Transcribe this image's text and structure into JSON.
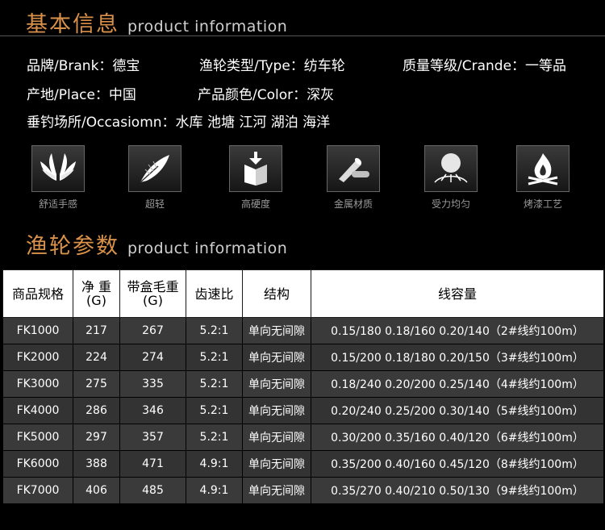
{
  "section1": {
    "title_cn": "基本信息",
    "title_en": "product information"
  },
  "info": {
    "row1": [
      "品牌/Brank：德宝",
      "渔轮类型/Type：纺车轮",
      "质量等级/Crande：一等品"
    ],
    "row2": [
      "产地/Place：中国",
      "产品颜色/Color：深灰"
    ],
    "row3": [
      "垂钓场所/Occasiomn：水库  池塘  江河  湖泊  海洋"
    ]
  },
  "features": [
    {
      "label": "舒适手感",
      "icon": "hands-icon"
    },
    {
      "label": "超轻",
      "icon": "feather-icon"
    },
    {
      "label": "高硬度",
      "icon": "hardness-icon"
    },
    {
      "label": "金属材质",
      "icon": "metal-rod-icon"
    },
    {
      "label": "受力均匀",
      "icon": "force-ball-icon"
    },
    {
      "label": "烤漆工艺",
      "icon": "flame-icon"
    }
  ],
  "section2": {
    "title_cn": "渔轮参数",
    "title_en": "product information"
  },
  "table": {
    "headers": [
      "商品规格",
      "净 重\n(G)",
      "带盒毛重\n(G)",
      "齿速比",
      "结构",
      "线容量"
    ],
    "rows": [
      [
        "FK1000",
        "217",
        "267",
        "5.2:1",
        "单向无间隙",
        "0.15/180  0.18/160  0.20/140（2#线约100m）"
      ],
      [
        "FK2000",
        "224",
        "274",
        "5.2:1",
        "单向无间隙",
        "0.15/200  0.18/180  0.20/150（3#线约100m）"
      ],
      [
        "FK3000",
        "275",
        "335",
        "5.2:1",
        "单向无间隙",
        "0.18/240  0.20/200  0.25/140（4#线约100m）"
      ],
      [
        "FK4000",
        "286",
        "346",
        "5.2:1",
        "单向无间隙",
        "0.20/240  0.25/200  0.30/140（5#线约100m）"
      ],
      [
        "FK5000",
        "297",
        "357",
        "5.2:1",
        "单向无间隙",
        "0.30/200  0.35/160  0.40/120（6#线约100m）"
      ],
      [
        "FK6000",
        "388",
        "471",
        "4.9:1",
        "单向无间隙",
        "0.35/200  0.40/160  0.45/120（8#线约100m）"
      ],
      [
        "FK7000",
        "406",
        "485",
        "4.9:1",
        "单向无间隙",
        "0.35/270  0.40/210  0.50/130（9#线约100m）"
      ]
    ]
  }
}
